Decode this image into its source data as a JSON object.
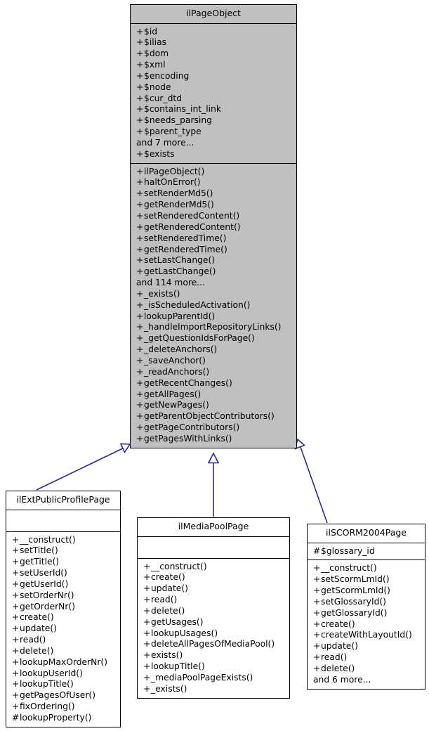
{
  "diagram": {
    "kind": "uml-class-diagram",
    "title": "ilPageObject class hierarchy",
    "colors": {
      "base_class_fill": "#c0c0c0",
      "derived_class_fill": "#ffffff",
      "border": "#000000",
      "connector": "#2a2a8c",
      "background": "#ffffff"
    },
    "relations": [
      {
        "type": "generalization",
        "from": "ilExtPublicProfilePage",
        "to": "ilPageObject"
      },
      {
        "type": "generalization",
        "from": "ilMediaPoolPage",
        "to": "ilPageObject"
      },
      {
        "type": "generalization",
        "from": "ilSCORM2004Page",
        "to": "ilPageObject"
      }
    ]
  },
  "classes": {
    "ilPageObject": {
      "name": "ilPageObject",
      "attributes": [
        {
          "vis": "+",
          "label": "$id"
        },
        {
          "vis": "+",
          "label": "$ilias"
        },
        {
          "vis": "+",
          "label": "$dom"
        },
        {
          "vis": "+",
          "label": "$xml"
        },
        {
          "vis": "+",
          "label": "$encoding"
        },
        {
          "vis": "+",
          "label": "$node"
        },
        {
          "vis": "+",
          "label": "$cur_dtd"
        },
        {
          "vis": "+",
          "label": "$contains_int_link"
        },
        {
          "vis": "+",
          "label": "$needs_parsing"
        },
        {
          "vis": "+",
          "label": "$parent_type"
        },
        {
          "vis": "",
          "label": "and 7 more..."
        },
        {
          "vis": "+",
          "label": "$exists"
        }
      ],
      "methods": [
        {
          "vis": "+",
          "label": "ilPageObject()"
        },
        {
          "vis": "+",
          "label": "haltOnError()"
        },
        {
          "vis": "+",
          "label": "setRenderMd5()"
        },
        {
          "vis": "+",
          "label": "getRenderMd5()"
        },
        {
          "vis": "+",
          "label": "setRenderedContent()"
        },
        {
          "vis": "+",
          "label": "getRenderedContent()"
        },
        {
          "vis": "+",
          "label": "setRenderedTime()"
        },
        {
          "vis": "+",
          "label": "getRenderedTime()"
        },
        {
          "vis": "+",
          "label": "setLastChange()"
        },
        {
          "vis": "+",
          "label": "getLastChange()"
        },
        {
          "vis": "",
          "label": "and 114 more..."
        },
        {
          "vis": "+",
          "label": "_exists()"
        },
        {
          "vis": "+",
          "label": "_isScheduledActivation()"
        },
        {
          "vis": "+",
          "label": "lookupParentId()"
        },
        {
          "vis": "+",
          "label": "_handleImportRepositoryLinks()"
        },
        {
          "vis": "+",
          "label": "_getQuestionIdsForPage()"
        },
        {
          "vis": "+",
          "label": "_deleteAnchors()"
        },
        {
          "vis": "+",
          "label": "_saveAnchor()"
        },
        {
          "vis": "+",
          "label": "_readAnchors()"
        },
        {
          "vis": "+",
          "label": "getRecentChanges()"
        },
        {
          "vis": "+",
          "label": "getAllPages()"
        },
        {
          "vis": "+",
          "label": "getNewPages()"
        },
        {
          "vis": "+",
          "label": "getParentObjectContributors()"
        },
        {
          "vis": "+",
          "label": "getPageContributors()"
        },
        {
          "vis": "+",
          "label": "getPagesWithLinks()"
        }
      ]
    },
    "ilExtPublicProfilePage": {
      "name": "ilExtPublicProfilePage",
      "attributes": [],
      "methods": [
        {
          "vis": "+",
          "label": "__construct()"
        },
        {
          "vis": "+",
          "label": "setTitle()"
        },
        {
          "vis": "+",
          "label": "getTitle()"
        },
        {
          "vis": "+",
          "label": "setUserId()"
        },
        {
          "vis": "+",
          "label": "getUserId()"
        },
        {
          "vis": "+",
          "label": "setOrderNr()"
        },
        {
          "vis": "+",
          "label": "getOrderNr()"
        },
        {
          "vis": "+",
          "label": "create()"
        },
        {
          "vis": "+",
          "label": "update()"
        },
        {
          "vis": "+",
          "label": "read()"
        },
        {
          "vis": "+",
          "label": "delete()"
        },
        {
          "vis": "+",
          "label": "lookupMaxOrderNr()"
        },
        {
          "vis": "+",
          "label": "lookupUserId()"
        },
        {
          "vis": "+",
          "label": "lookupTitle()"
        },
        {
          "vis": "+",
          "label": "getPagesOfUser()"
        },
        {
          "vis": "+",
          "label": "fixOrdering()"
        },
        {
          "vis": "#",
          "label": "lookupProperty()"
        }
      ]
    },
    "ilMediaPoolPage": {
      "name": "ilMediaPoolPage",
      "attributes": [],
      "methods": [
        {
          "vis": "+",
          "label": "__construct()"
        },
        {
          "vis": "+",
          "label": "create()"
        },
        {
          "vis": "+",
          "label": "update()"
        },
        {
          "vis": "+",
          "label": "read()"
        },
        {
          "vis": "+",
          "label": "delete()"
        },
        {
          "vis": "+",
          "label": "getUsages()"
        },
        {
          "vis": "+",
          "label": "lookupUsages()"
        },
        {
          "vis": "+",
          "label": "deleteAllPagesOfMediaPool()"
        },
        {
          "vis": "+",
          "label": "exists()"
        },
        {
          "vis": "+",
          "label": "lookupTitle()"
        },
        {
          "vis": "+",
          "label": "_mediaPoolPageExists()"
        },
        {
          "vis": "+",
          "label": "_exists()"
        }
      ]
    },
    "ilSCORM2004Page": {
      "name": "ilSCORM2004Page",
      "attributes": [
        {
          "vis": "#",
          "label": "$glossary_id"
        }
      ],
      "methods": [
        {
          "vis": "+",
          "label": "__construct()"
        },
        {
          "vis": "+",
          "label": "setScormLmId()"
        },
        {
          "vis": "+",
          "label": "getScormLmId()"
        },
        {
          "vis": "+",
          "label": "setGlossaryId()"
        },
        {
          "vis": "+",
          "label": "getGlossaryId()"
        },
        {
          "vis": "+",
          "label": "create()"
        },
        {
          "vis": "+",
          "label": "createWithLayoutId()"
        },
        {
          "vis": "+",
          "label": "update()"
        },
        {
          "vis": "+",
          "label": "read()"
        },
        {
          "vis": "+",
          "label": "delete()"
        },
        {
          "vis": "",
          "label": "and 6 more..."
        }
      ]
    }
  }
}
